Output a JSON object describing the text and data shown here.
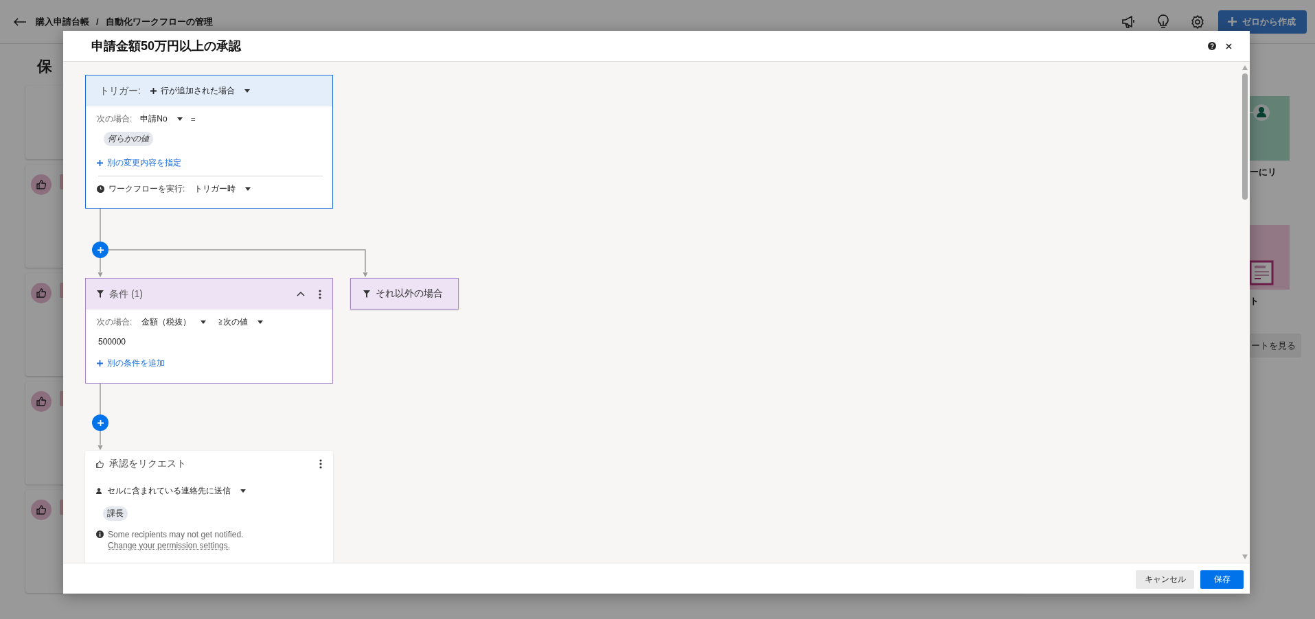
{
  "page": {
    "breadcrumb": [
      "購入申請台帳",
      "自動化ワークフローの管理"
    ],
    "separator": "/",
    "create_button": "ゼロから作成",
    "heading": "保",
    "left_cards": [
      {
        "kind": "plain"
      },
      {
        "kind": "approval"
      },
      {
        "kind": "approval"
      },
      {
        "kind": "approval"
      },
      {
        "kind": "approval"
      }
    ],
    "right_items": [
      {
        "kind": "person",
        "caption": "ーにリ"
      },
      {
        "kind": "document",
        "caption": "ト"
      }
    ],
    "right_button": "ートを見る"
  },
  "modal": {
    "title": "申請金額50万円以上の承認",
    "trigger": {
      "label": "トリガー:",
      "event": "行が追加された場合",
      "when_label": "次の場合:",
      "field": "申請No",
      "operator": "=",
      "value_chip": "何らかの値",
      "add_link": "別の変更内容を指定",
      "run_label": "ワークフローを実行:",
      "run_value": "トリガー時"
    },
    "condition": {
      "title": "条件 (1)",
      "expanded": true,
      "when_label": "次の場合:",
      "field": "金額（税抜）",
      "operator": "≧次の値",
      "value": "500000",
      "add_link": "別の条件を追加"
    },
    "otherwise": {
      "title": "それ以外の場合"
    },
    "approval": {
      "title": "承認をリクエスト",
      "send": "セルに含まれている連絡先に送信",
      "chip": "課長",
      "warning": "Some recipients may not get notified.",
      "link": "Change your permission settings."
    },
    "footer": {
      "cancel": "キャンセル",
      "save": "保存"
    }
  }
}
